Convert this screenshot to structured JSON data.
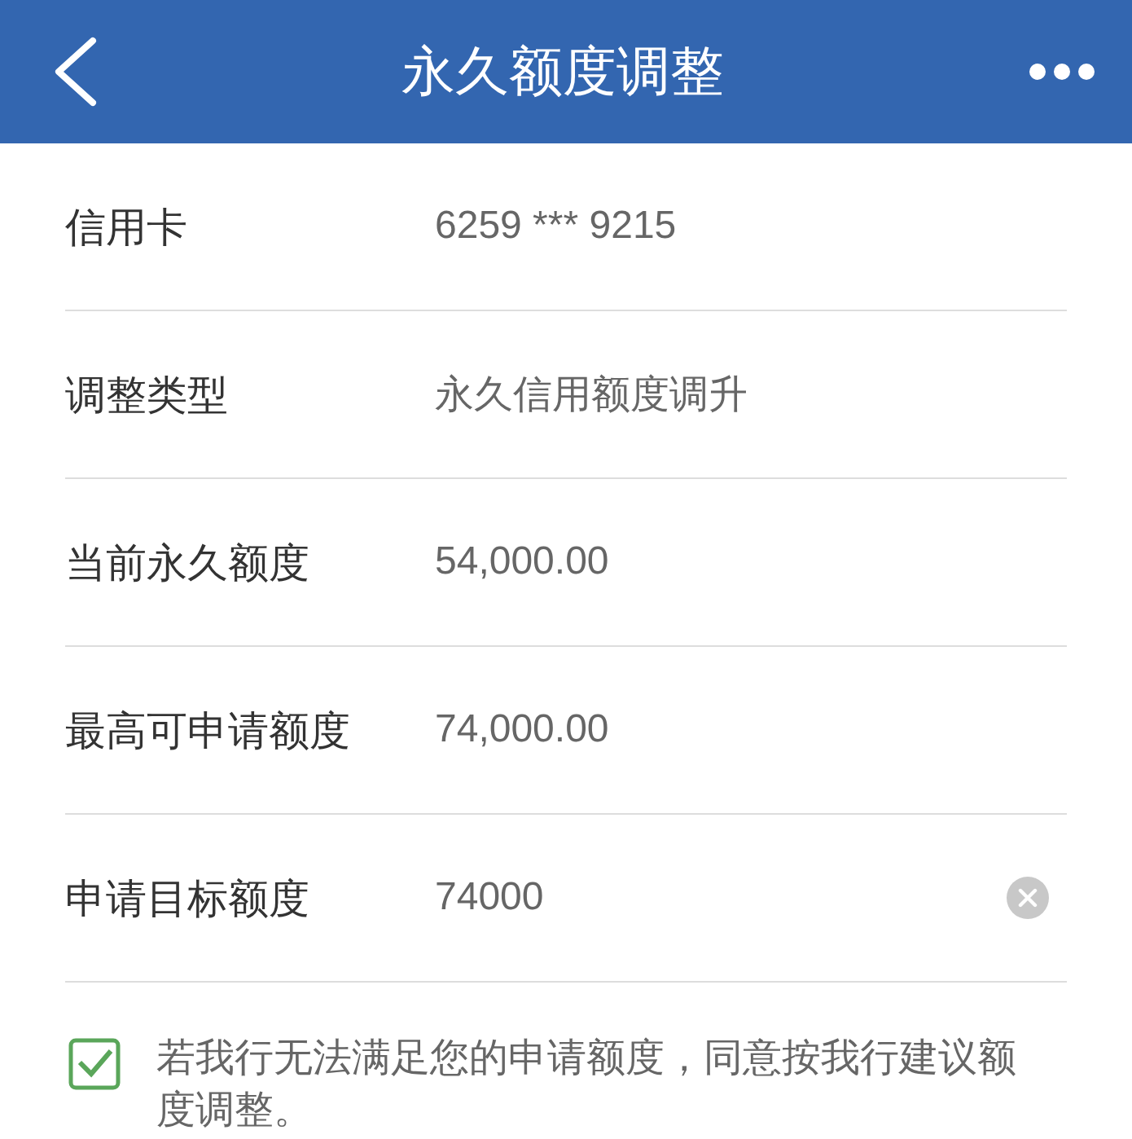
{
  "header": {
    "title": "永久额度调整"
  },
  "rows": [
    {
      "kind": "text",
      "label": "信用卡",
      "value": "6259 *** 9215"
    },
    {
      "kind": "text",
      "label": "调整类型",
      "value": "永久信用额度调升"
    },
    {
      "kind": "text",
      "label": "当前永久额度",
      "value": "54,000.00"
    },
    {
      "kind": "text",
      "label": "最高可申请额度",
      "value": "74,000.00"
    },
    {
      "kind": "input",
      "label": "申请目标额度",
      "value": "74000"
    }
  ],
  "agreement": {
    "checked": true,
    "text": "若我行无法满足您的申请额度，同意按我行建议额度调整。"
  }
}
